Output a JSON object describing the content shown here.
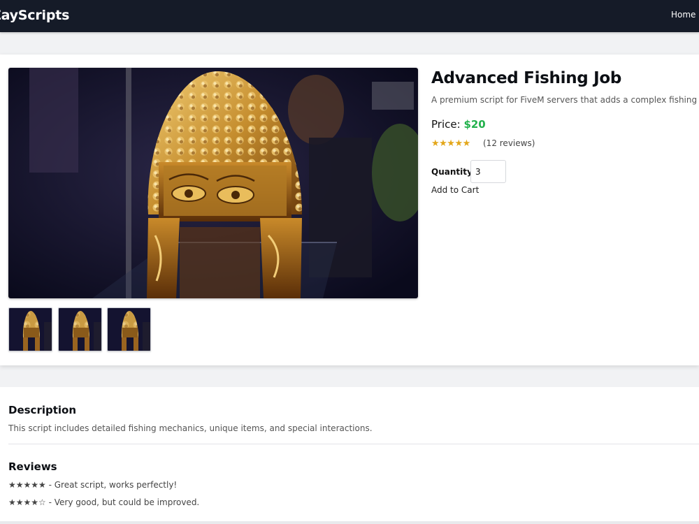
{
  "navbar": {
    "brand": "ZayScripts",
    "home_link": "Home"
  },
  "product": {
    "title": "Advanced Fishing Job",
    "short_description": "A premium script for FiveM servers that adds a complex fishing system",
    "price_label": "Price:",
    "price_value": "$20",
    "stars": "★★★★★",
    "review_count": "(12 reviews)",
    "quantity_label": "Quantity:",
    "quantity_value": "3",
    "add_to_cart_label": "Add to Cart",
    "main_image_icon": "golden-helmet-photo",
    "thumbnails": [
      "golden-helmet-thumbnail",
      "golden-helmet-thumbnail",
      "golden-helmet-thumbnail"
    ]
  },
  "description": {
    "heading": "Description",
    "text": "This script includes detailed fishing mechanics, unique items, and special interactions."
  },
  "reviews": {
    "heading": "Reviews",
    "items": [
      {
        "stars": "★★★★★",
        "text": " - Great script, works perfectly!"
      },
      {
        "stars": "★★★★☆",
        "text": " - Very good, but could be improved."
      }
    ]
  },
  "colors": {
    "navbar_bg": "#151b28",
    "price_green": "#22b14c",
    "star_gold": "#e3a71b",
    "page_bg": "#f1f2f4"
  }
}
